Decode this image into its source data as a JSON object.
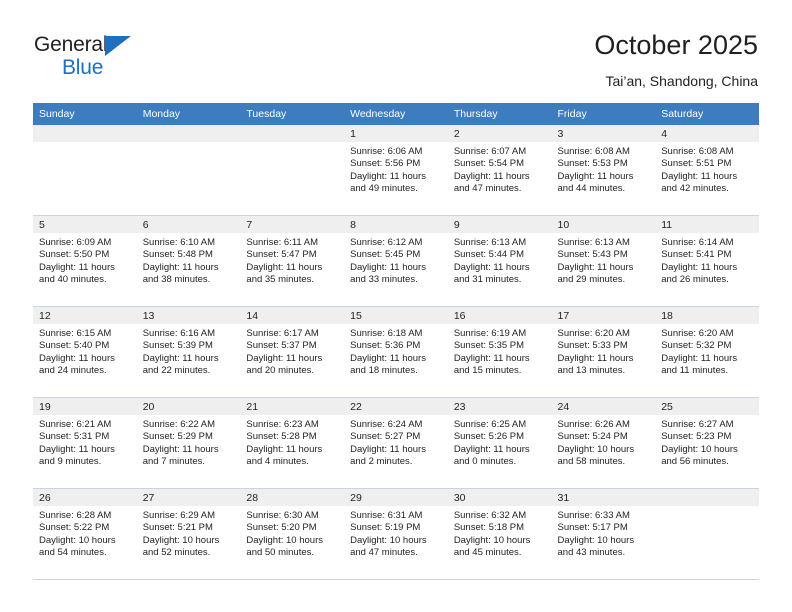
{
  "brand": {
    "name_part1": "General",
    "name_part2": "Blue",
    "logo_icon": "triangle-logo-icon"
  },
  "header": {
    "title": "October 2025",
    "subtitle": "Tai’an, Shandong, China"
  },
  "weekday_headers": [
    "Sunday",
    "Monday",
    "Tuesday",
    "Wednesday",
    "Thursday",
    "Friday",
    "Saturday"
  ],
  "colors": {
    "header_blue": "#3c7cbf",
    "brand_blue": "#1f6fc0",
    "daynum_band": "#efefef",
    "text": "#231f20",
    "row_divider": "#c8d4e2"
  },
  "labels": {
    "sunrise_prefix": "Sunrise:",
    "sunset_prefix": "Sunset:",
    "daylight_prefix": "Daylight:"
  },
  "weeks": [
    [
      {
        "blank": true
      },
      {
        "blank": true
      },
      {
        "blank": true
      },
      {
        "day": "1",
        "sunrise": "Sunrise: 6:06 AM",
        "sunset": "Sunset: 5:56 PM",
        "daylight_line1": "Daylight: 11 hours",
        "daylight_line2": "and 49 minutes."
      },
      {
        "day": "2",
        "sunrise": "Sunrise: 6:07 AM",
        "sunset": "Sunset: 5:54 PM",
        "daylight_line1": "Daylight: 11 hours",
        "daylight_line2": "and 47 minutes."
      },
      {
        "day": "3",
        "sunrise": "Sunrise: 6:08 AM",
        "sunset": "Sunset: 5:53 PM",
        "daylight_line1": "Daylight: 11 hours",
        "daylight_line2": "and 44 minutes."
      },
      {
        "day": "4",
        "sunrise": "Sunrise: 6:08 AM",
        "sunset": "Sunset: 5:51 PM",
        "daylight_line1": "Daylight: 11 hours",
        "daylight_line2": "and 42 minutes."
      }
    ],
    [
      {
        "day": "5",
        "sunrise": "Sunrise: 6:09 AM",
        "sunset": "Sunset: 5:50 PM",
        "daylight_line1": "Daylight: 11 hours",
        "daylight_line2": "and 40 minutes."
      },
      {
        "day": "6",
        "sunrise": "Sunrise: 6:10 AM",
        "sunset": "Sunset: 5:48 PM",
        "daylight_line1": "Daylight: 11 hours",
        "daylight_line2": "and 38 minutes."
      },
      {
        "day": "7",
        "sunrise": "Sunrise: 6:11 AM",
        "sunset": "Sunset: 5:47 PM",
        "daylight_line1": "Daylight: 11 hours",
        "daylight_line2": "and 35 minutes."
      },
      {
        "day": "8",
        "sunrise": "Sunrise: 6:12 AM",
        "sunset": "Sunset: 5:45 PM",
        "daylight_line1": "Daylight: 11 hours",
        "daylight_line2": "and 33 minutes."
      },
      {
        "day": "9",
        "sunrise": "Sunrise: 6:13 AM",
        "sunset": "Sunset: 5:44 PM",
        "daylight_line1": "Daylight: 11 hours",
        "daylight_line2": "and 31 minutes."
      },
      {
        "day": "10",
        "sunrise": "Sunrise: 6:13 AM",
        "sunset": "Sunset: 5:43 PM",
        "daylight_line1": "Daylight: 11 hours",
        "daylight_line2": "and 29 minutes."
      },
      {
        "day": "11",
        "sunrise": "Sunrise: 6:14 AM",
        "sunset": "Sunset: 5:41 PM",
        "daylight_line1": "Daylight: 11 hours",
        "daylight_line2": "and 26 minutes."
      }
    ],
    [
      {
        "day": "12",
        "sunrise": "Sunrise: 6:15 AM",
        "sunset": "Sunset: 5:40 PM",
        "daylight_line1": "Daylight: 11 hours",
        "daylight_line2": "and 24 minutes."
      },
      {
        "day": "13",
        "sunrise": "Sunrise: 6:16 AM",
        "sunset": "Sunset: 5:39 PM",
        "daylight_line1": "Daylight: 11 hours",
        "daylight_line2": "and 22 minutes."
      },
      {
        "day": "14",
        "sunrise": "Sunrise: 6:17 AM",
        "sunset": "Sunset: 5:37 PM",
        "daylight_line1": "Daylight: 11 hours",
        "daylight_line2": "and 20 minutes."
      },
      {
        "day": "15",
        "sunrise": "Sunrise: 6:18 AM",
        "sunset": "Sunset: 5:36 PM",
        "daylight_line1": "Daylight: 11 hours",
        "daylight_line2": "and 18 minutes."
      },
      {
        "day": "16",
        "sunrise": "Sunrise: 6:19 AM",
        "sunset": "Sunset: 5:35 PM",
        "daylight_line1": "Daylight: 11 hours",
        "daylight_line2": "and 15 minutes."
      },
      {
        "day": "17",
        "sunrise": "Sunrise: 6:20 AM",
        "sunset": "Sunset: 5:33 PM",
        "daylight_line1": "Daylight: 11 hours",
        "daylight_line2": "and 13 minutes."
      },
      {
        "day": "18",
        "sunrise": "Sunrise: 6:20 AM",
        "sunset": "Sunset: 5:32 PM",
        "daylight_line1": "Daylight: 11 hours",
        "daylight_line2": "and 11 minutes."
      }
    ],
    [
      {
        "day": "19",
        "sunrise": "Sunrise: 6:21 AM",
        "sunset": "Sunset: 5:31 PM",
        "daylight_line1": "Daylight: 11 hours",
        "daylight_line2": "and 9 minutes."
      },
      {
        "day": "20",
        "sunrise": "Sunrise: 6:22 AM",
        "sunset": "Sunset: 5:29 PM",
        "daylight_line1": "Daylight: 11 hours",
        "daylight_line2": "and 7 minutes."
      },
      {
        "day": "21",
        "sunrise": "Sunrise: 6:23 AM",
        "sunset": "Sunset: 5:28 PM",
        "daylight_line1": "Daylight: 11 hours",
        "daylight_line2": "and 4 minutes."
      },
      {
        "day": "22",
        "sunrise": "Sunrise: 6:24 AM",
        "sunset": "Sunset: 5:27 PM",
        "daylight_line1": "Daylight: 11 hours",
        "daylight_line2": "and 2 minutes."
      },
      {
        "day": "23",
        "sunrise": "Sunrise: 6:25 AM",
        "sunset": "Sunset: 5:26 PM",
        "daylight_line1": "Daylight: 11 hours",
        "daylight_line2": "and 0 minutes."
      },
      {
        "day": "24",
        "sunrise": "Sunrise: 6:26 AM",
        "sunset": "Sunset: 5:24 PM",
        "daylight_line1": "Daylight: 10 hours",
        "daylight_line2": "and 58 minutes."
      },
      {
        "day": "25",
        "sunrise": "Sunrise: 6:27 AM",
        "sunset": "Sunset: 5:23 PM",
        "daylight_line1": "Daylight: 10 hours",
        "daylight_line2": "and 56 minutes."
      }
    ],
    [
      {
        "day": "26",
        "sunrise": "Sunrise: 6:28 AM",
        "sunset": "Sunset: 5:22 PM",
        "daylight_line1": "Daylight: 10 hours",
        "daylight_line2": "and 54 minutes."
      },
      {
        "day": "27",
        "sunrise": "Sunrise: 6:29 AM",
        "sunset": "Sunset: 5:21 PM",
        "daylight_line1": "Daylight: 10 hours",
        "daylight_line2": "and 52 minutes."
      },
      {
        "day": "28",
        "sunrise": "Sunrise: 6:30 AM",
        "sunset": "Sunset: 5:20 PM",
        "daylight_line1": "Daylight: 10 hours",
        "daylight_line2": "and 50 minutes."
      },
      {
        "day": "29",
        "sunrise": "Sunrise: 6:31 AM",
        "sunset": "Sunset: 5:19 PM",
        "daylight_line1": "Daylight: 10 hours",
        "daylight_line2": "and 47 minutes."
      },
      {
        "day": "30",
        "sunrise": "Sunrise: 6:32 AM",
        "sunset": "Sunset: 5:18 PM",
        "daylight_line1": "Daylight: 10 hours",
        "daylight_line2": "and 45 minutes."
      },
      {
        "day": "31",
        "sunrise": "Sunrise: 6:33 AM",
        "sunset": "Sunset: 5:17 PM",
        "daylight_line1": "Daylight: 10 hours",
        "daylight_line2": "and 43 minutes."
      },
      {
        "blank": true
      }
    ]
  ]
}
